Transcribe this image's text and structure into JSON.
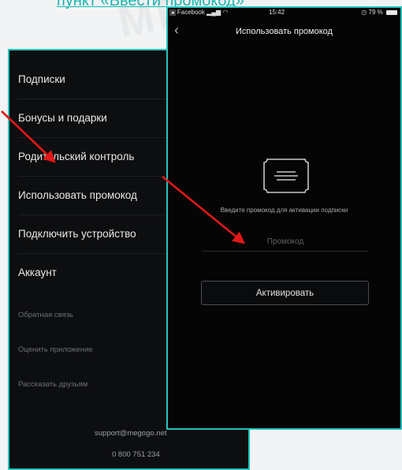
{
  "slide": {
    "heading": "пункт «Ввести промокод»",
    "watermark": "ME"
  },
  "left_screen": {
    "menu_items": [
      "Подписки",
      "Бонусы и подарки",
      "Родительский контроль",
      "Использовать промокод",
      "Подключить устройство",
      "Аккаунт"
    ],
    "secondary_items": [
      "Обратная связь",
      "Оценить приложение",
      "Рассказать друзьям"
    ],
    "support_email": "support@megogo.net",
    "support_phone": "0 800 751 234"
  },
  "right_screen": {
    "status_bar": {
      "back_app": "Facebook",
      "time": "15:42",
      "battery": "79 %"
    },
    "title": "Использовать промокод",
    "hint": "Введите промокод для активации подписки",
    "promo_placeholder": "Промокод",
    "promo_value": "",
    "activate_label": "Активировать"
  },
  "colors": {
    "accent": "#22c4bc",
    "arrow": "#e01818"
  }
}
